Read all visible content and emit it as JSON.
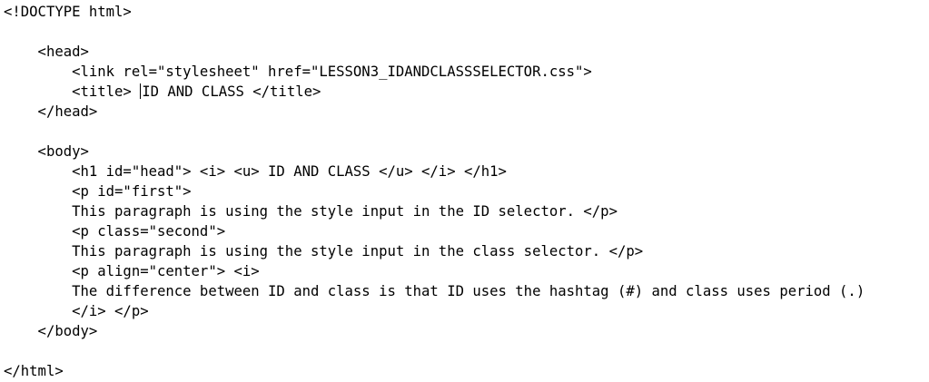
{
  "editor": {
    "lines": [
      "<!DOCTYPE html>",
      "",
      "    <head>",
      "        <link rel=\"stylesheet\" href=\"LESSON3_IDANDCLASSSELECTOR.css\">",
      "        <title> ",
      "    </head>",
      "",
      "    <body>",
      "        <h1 id=\"head\"> <i> <u> ID AND CLASS </u> </i> </h1>",
      "        <p id=\"first\">",
      "        This paragraph is using the style input in the ID selector. </p>",
      "        <p class=\"second\">",
      "        This paragraph is using the style input in the class selector. </p>",
      "        <p align=\"center\"> <i>",
      "        The difference between ID and class is that ID uses the hashtag (#) and class uses period (.)",
      "        </i> </p>",
      "    </body>",
      "",
      "</html>"
    ],
    "caret_line_after": "ID AND CLASS </title>"
  }
}
